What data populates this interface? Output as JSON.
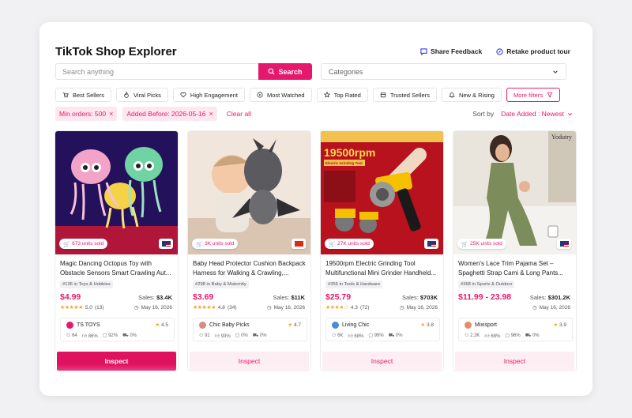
{
  "app": {
    "title": "TikTok Shop Explorer"
  },
  "header": {
    "share_feedback": "Share Feedback",
    "retake_tour": "Retake product tour"
  },
  "search": {
    "placeholder": "Search anything",
    "button_label": "Search",
    "categories_placeholder": "Categories"
  },
  "quick_filters": [
    {
      "label": "Best Sellers",
      "icon": "cart-icon"
    },
    {
      "label": "Viral Picks",
      "icon": "flame-icon"
    },
    {
      "label": "High Engagement",
      "icon": "heart-icon"
    },
    {
      "label": "Most Watched",
      "icon": "play-icon"
    },
    {
      "label": "Top Rated",
      "icon": "star-icon"
    },
    {
      "label": "Trusted Sellers",
      "icon": "store-icon"
    },
    {
      "label": "New & Rising",
      "icon": "bell-icon"
    },
    {
      "label": "More filters",
      "icon": "filter-icon"
    }
  ],
  "active_filters": [
    {
      "label": "Min orders: 500"
    },
    {
      "label": "Added Before: 2026-05-16"
    }
  ],
  "clear_all": "Clear all",
  "sort": {
    "label": "Sort by",
    "value": "Date Added : Newest"
  },
  "colors": {
    "accent": "#e6186d",
    "star": "#f5a623"
  },
  "products": [
    {
      "units_sold": "673 units sold",
      "name": "Magic Dancing Octopus Toy with Obstacle Sensors Smart Crawling Aut...",
      "category": "#136 in Toys & Hobbies",
      "price": "$4.99",
      "sales_label": "Sales:",
      "sales": "$3.4K",
      "rating": "5.0",
      "rating_count": "(13)",
      "date": "May 16, 2026",
      "shop": {
        "name": "TS TOYS",
        "rating": "4.5",
        "followers": "64",
        "positive": "86%",
        "ship": "92%",
        "returns": "0%",
        "logo_color": "#e6186d"
      },
      "flag": "us",
      "button": "Inspect"
    },
    {
      "units_sold": "3K units sold",
      "name": "Baby Head Protector Cushion Backpack Harness for Walking & Crawling,...",
      "category": "#298 in Baby & Maternity",
      "price": "$3.69",
      "sales_label": "Sales:",
      "sales": "$11K",
      "rating": "4.8",
      "rating_count": "(34)",
      "date": "May 16, 2026",
      "shop": {
        "name": "Chic Baby Picks",
        "rating": "4.7",
        "followers": "91",
        "positive": "93%",
        "ship": "0%",
        "returns": "0%",
        "logo_color": "#d98a8a"
      },
      "flag": "cn",
      "button": "Inspect"
    },
    {
      "units_sold": "27K units sold",
      "name": "19500rpm Electric Grinding Tool Multifunctional Mini Grinder Handheld...",
      "category": "#356 in Tools & Hardware",
      "price": "$25.79",
      "sales_label": "Sales:",
      "sales": "$703K",
      "rating": "4.3",
      "rating_count": "(72)",
      "date": "May 16, 2026",
      "shop": {
        "name": "Living Chic",
        "rating": "3.8",
        "followers": "6K",
        "positive": "68%",
        "ship": "99%",
        "returns": "0%",
        "logo_color": "#4a8bd6"
      },
      "flag": "us",
      "button": "Inspect"
    },
    {
      "units_sold": "25K units sold",
      "name": "Women's Lace Trim Pajama Set – Spaghetti Strap Cami & Long Pants...",
      "category": "#368 in Sports & Outdoor",
      "price": "$11.99 - 23.98",
      "sales_label": "Sales:",
      "sales": "$301.2K",
      "rating": "",
      "rating_count": "",
      "date": "May 16, 2026",
      "shop": {
        "name": "Mixisport",
        "rating": "3.9",
        "followers": "2.3K",
        "positive": "68%",
        "ship": "96%",
        "returns": "0%",
        "logo_color": "#e88a6a"
      },
      "flag": "us",
      "button": "Inspect"
    }
  ],
  "image_text": {
    "grinder_speed": "19500rpm",
    "grinder_sub": "Electric Grinding Tool",
    "pajama_brand": "Yodutry"
  }
}
